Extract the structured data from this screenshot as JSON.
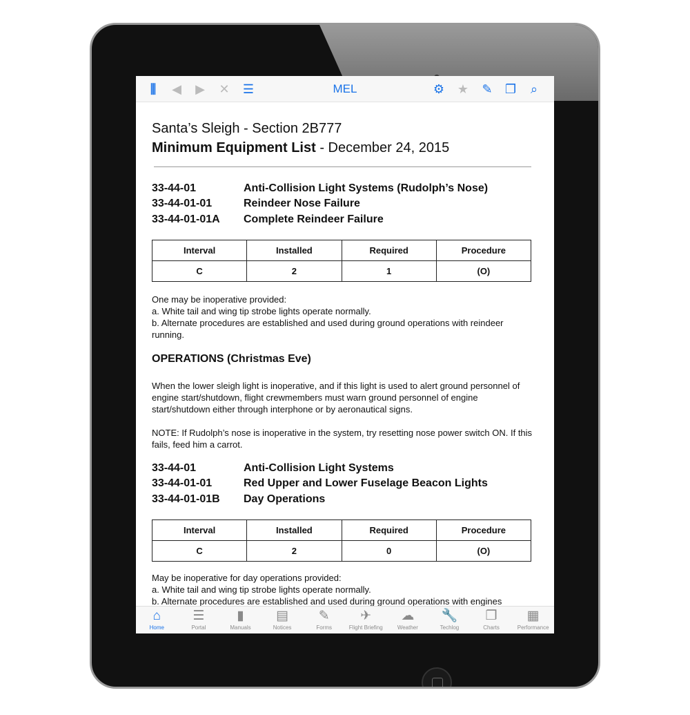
{
  "toolbar": {
    "title": "MEL",
    "left_icons": [
      "library-icon",
      "back-icon",
      "forward-icon",
      "airplane-off-icon",
      "list-icon"
    ],
    "right_icons": [
      "gear-icon",
      "star-icon",
      "pencil-icon",
      "copy-icon",
      "search-icon"
    ]
  },
  "header": {
    "line1": "Santa’s Sleigh - Section 2B777",
    "line2_bold": "Minimum Equipment List",
    "line2_rest": " - December 24, 2015"
  },
  "section1": {
    "codes": [
      {
        "code": "33-44-01",
        "title": "Anti-Collision Light Systems (Rudolph’s Nose)"
      },
      {
        "code": "33-44-01-01",
        "title": "Reindeer Nose Failure"
      },
      {
        "code": "33-44-01-01A",
        "title": "Complete Reindeer Failure"
      }
    ],
    "table": {
      "headers": [
        "Interval",
        "Installed",
        "Required",
        "Procedure"
      ],
      "row": [
        "C",
        "2",
        "1",
        "(O)"
      ]
    },
    "text": [
      "One may be inoperative provided:",
      "a.  White tail and wing tip strobe lights operate normally.",
      "b.  Alternate procedures are established and used during ground operations with reindeer running."
    ]
  },
  "operations": {
    "heading": "OPERATIONS (Christmas Eve)",
    "para": "When the lower sleigh light is inoperative, and if this light is used to alert ground personnel of engine start/shutdown, flight crewmembers must warn ground personnel of engine start/shutdown either through interphone or by aeronautical signs.",
    "note": "NOTE:   If Rudolph’s nose is inoperative in the system, try resetting nose power switch ON. If this fails, feed him a carrot."
  },
  "section2": {
    "codes": [
      {
        "code": "33-44-01",
        "title": "Anti-Collision Light Systems"
      },
      {
        "code": "33-44-01-01",
        "title": "Red Upper and Lower Fuselage Beacon Lights"
      },
      {
        "code": "33-44-01-01B",
        "title": "Day Operations"
      }
    ],
    "table": {
      "headers": [
        "Interval",
        "Installed",
        "Required",
        "Procedure"
      ],
      "row": [
        "C",
        "2",
        "0",
        "(O)"
      ]
    },
    "text": [
      "May be inoperative for day operations provided:",
      "a.  White tail and wing tip strobe lights operate normally.",
      "b.  Alternate procedures are established and used during ground operations with engines"
    ]
  },
  "tabs": [
    {
      "label": "Home",
      "icon": "home-icon",
      "glyph": "⌂"
    },
    {
      "label": "Portal",
      "icon": "portal-icon",
      "glyph": "☰"
    },
    {
      "label": "Manuals",
      "icon": "manuals-icon",
      "glyph": "▮"
    },
    {
      "label": "Notices",
      "icon": "notices-icon",
      "glyph": "▤"
    },
    {
      "label": "Forms",
      "icon": "pencil-icon",
      "glyph": "✎"
    },
    {
      "label": "Flight Briefing",
      "icon": "airplane-icon",
      "glyph": "✈"
    },
    {
      "label": "Weather",
      "icon": "cloud-icon",
      "glyph": "☁"
    },
    {
      "label": "Techlog",
      "icon": "wrench-icon",
      "glyph": "🔧"
    },
    {
      "label": "Charts",
      "icon": "charts-icon",
      "glyph": "❐"
    },
    {
      "label": "Performance",
      "icon": "calculator-icon",
      "glyph": "▦"
    }
  ],
  "colors": {
    "accent": "#1a73e8",
    "inactive": "#8a8a8a"
  }
}
